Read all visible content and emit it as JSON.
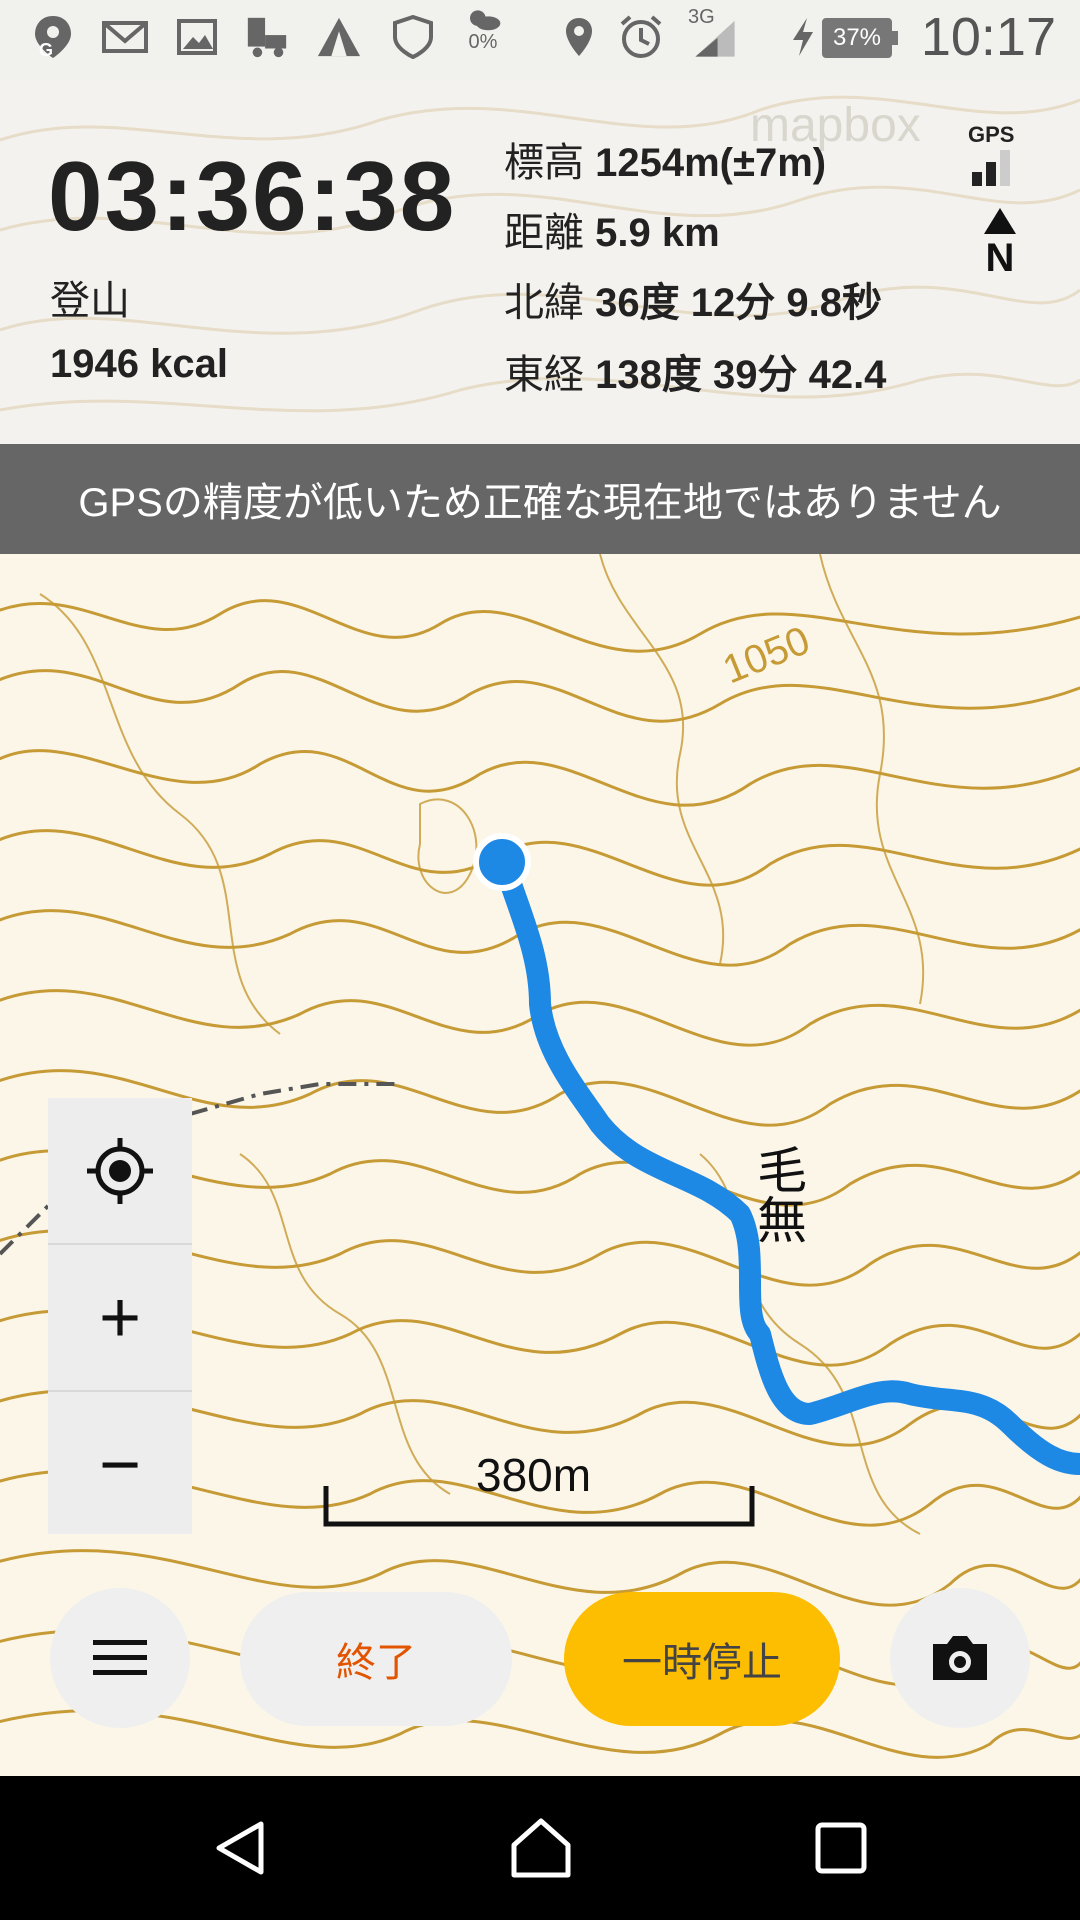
{
  "status_bar": {
    "weather_pct": "0%",
    "network": "3G",
    "battery": "37%",
    "time": "10:17"
  },
  "header": {
    "timer": "03:36:38",
    "activity": "登山",
    "calories": "1946 kcal",
    "elevation_label": "標高",
    "elevation_value": "1254m(±7m)",
    "distance_label": "距離",
    "distance_value": "5.9 km",
    "latitude_label": "北緯",
    "latitude_value": "36度 12分 9.8秒",
    "longitude_label": "東経",
    "longitude_value": "138度 39分 42.4",
    "gps_label": "GPS",
    "compass_label": "N",
    "attribution": "mapbox"
  },
  "warning": {
    "text": "GPSの精度が低いため正確な現在地ではありません"
  },
  "map": {
    "contour_label": "1050",
    "place_label": "毛無",
    "scale_label": "380m",
    "track_color": "#1e88e5",
    "contour_color": "#c69a35"
  },
  "controls": {
    "zoom_in": "+",
    "zoom_out": "−",
    "end_button": "終了",
    "pause_button": "一時停止",
    "end_color": "#e25400",
    "pause_bg": "#fdbd00"
  }
}
